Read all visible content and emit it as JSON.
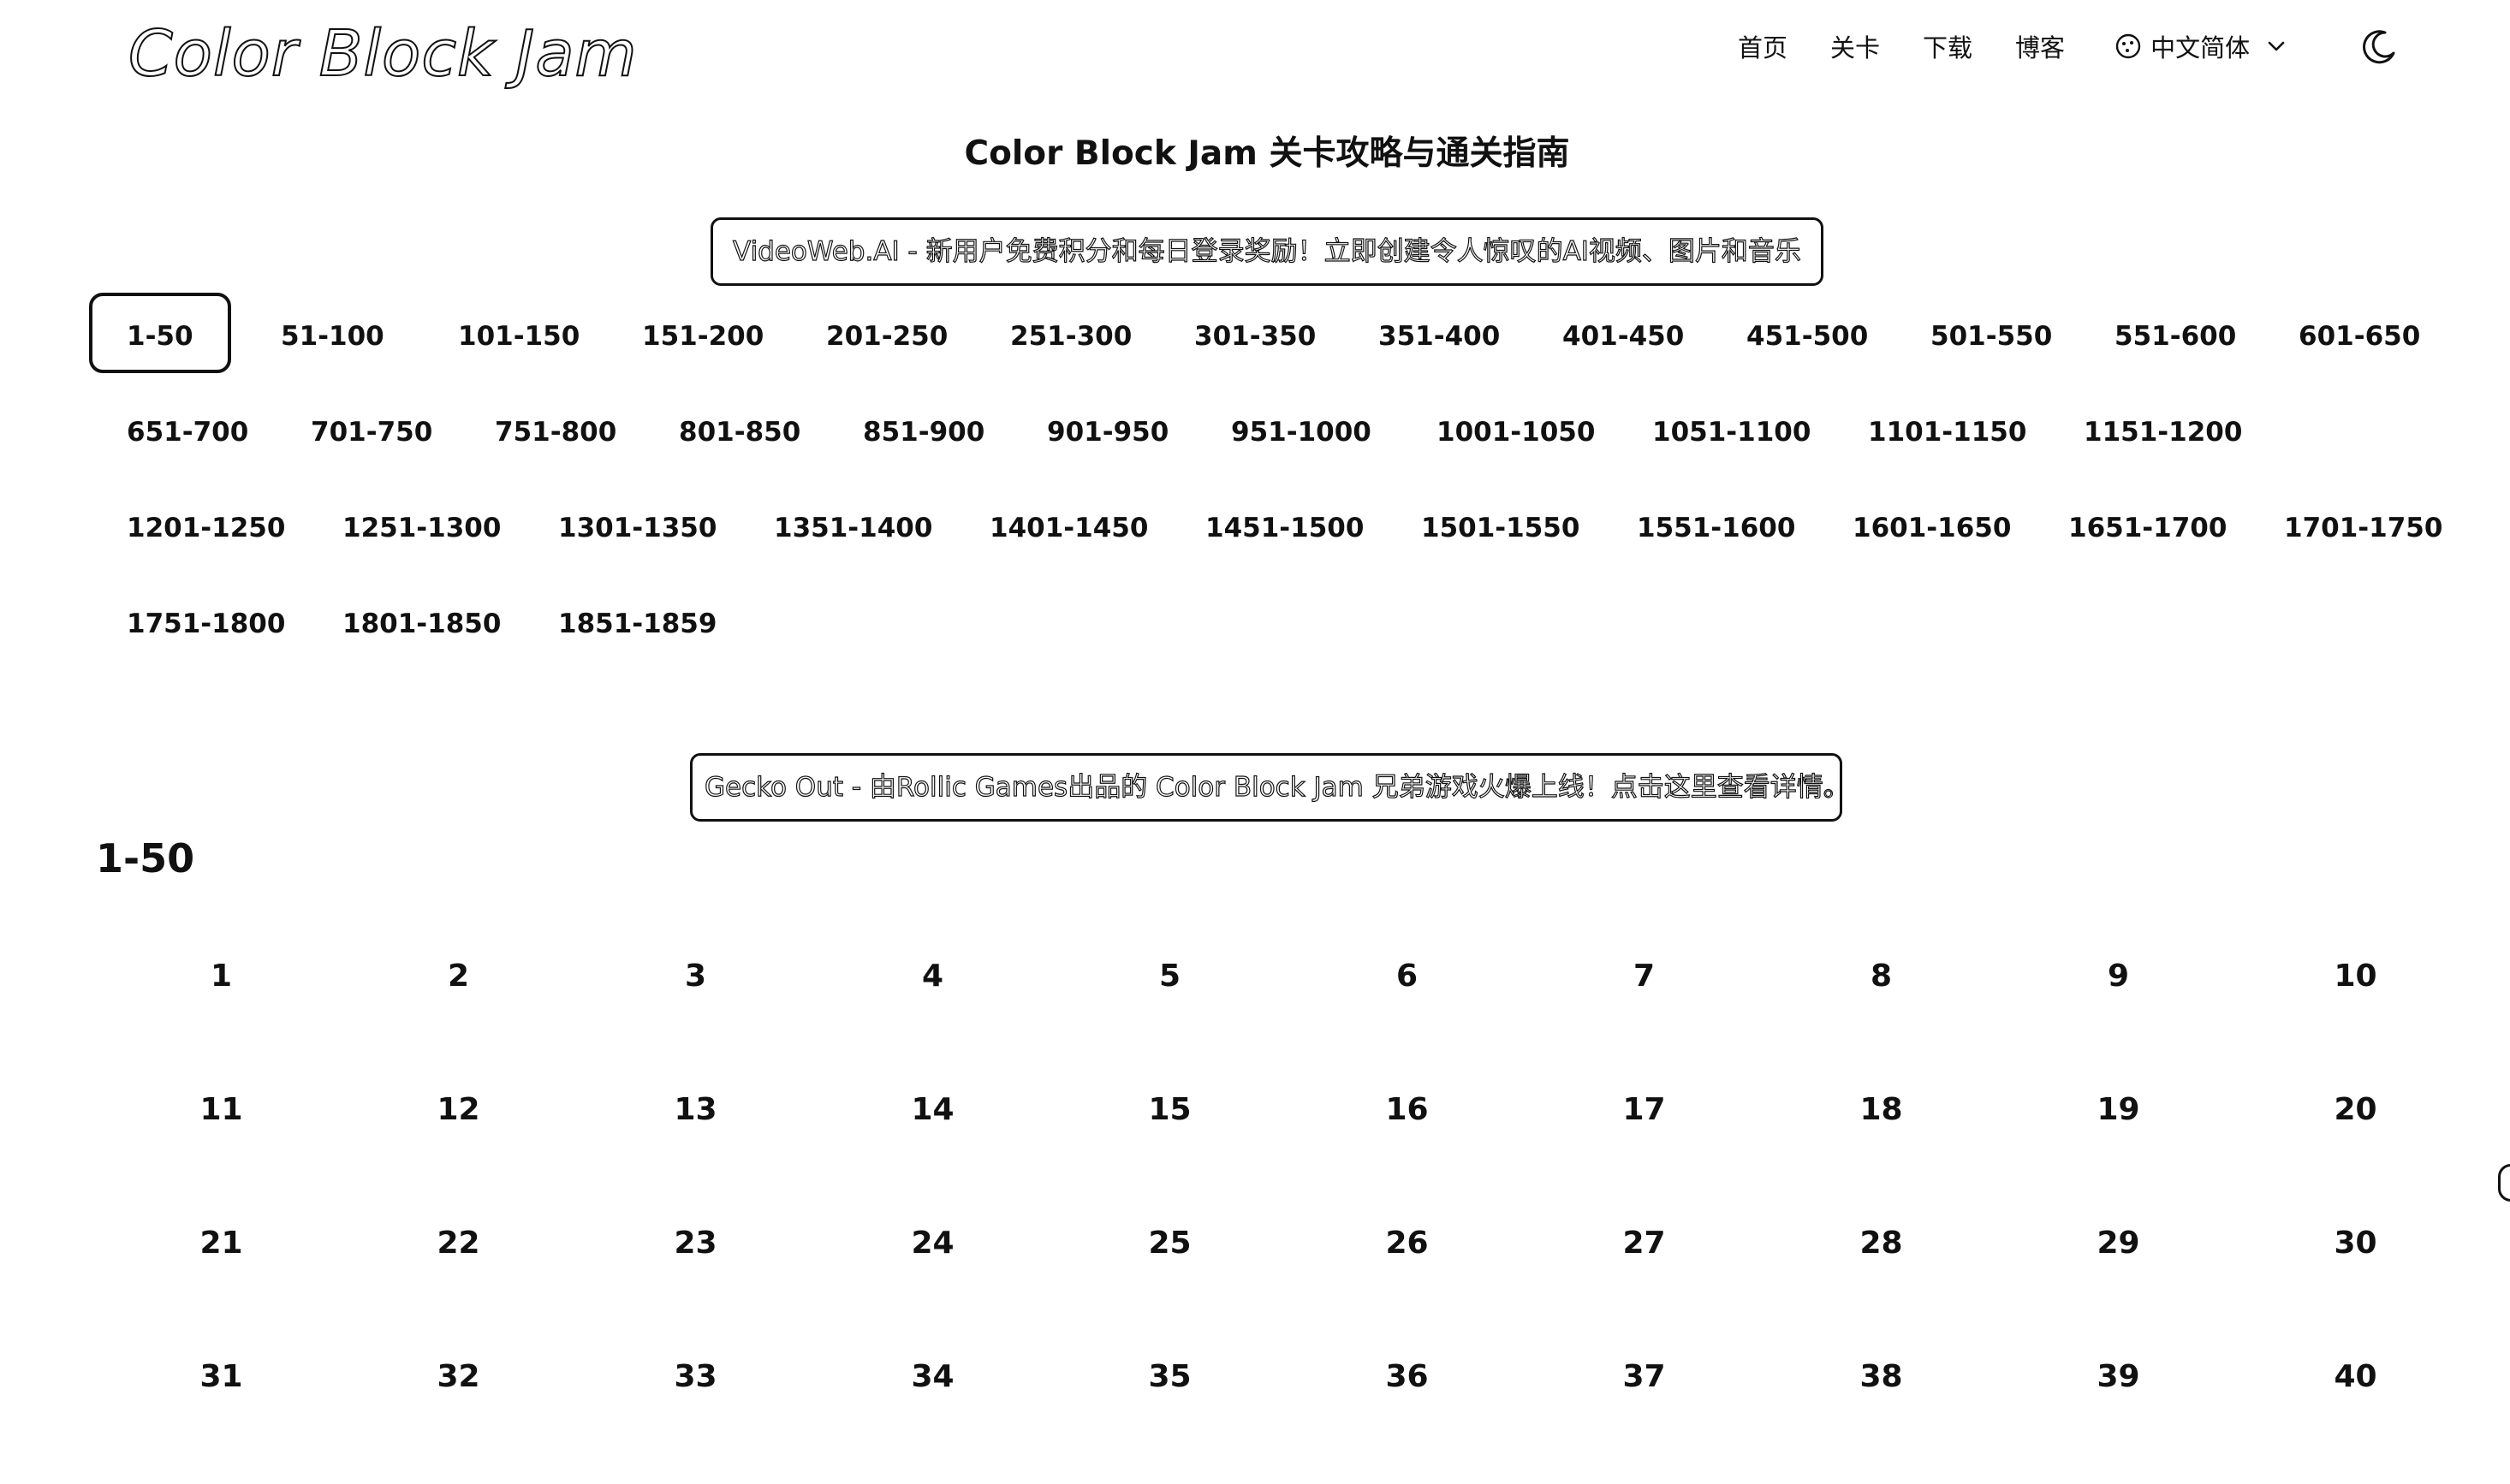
{
  "header": {
    "logo": "Color Block Jam",
    "nav": [
      {
        "label": "首页"
      },
      {
        "label": "关卡"
      },
      {
        "label": "下载"
      },
      {
        "label": "博客"
      }
    ],
    "language": "中文简体",
    "icons": {
      "language": "globe-icon",
      "dropdown": "chevron-down-icon",
      "theme": "moon-icon"
    }
  },
  "page_title": "Color Block Jam 关卡攻略与通关指南",
  "banners": {
    "top": "VideoWeb.AI - 新用户免费积分和每日登录奖励！立即创建令人惊叹的AI视频、图片和音乐",
    "bottom": "Gecko Out - 由Rollic Games出品的 Color Block Jam 兄弟游戏火爆上线！点击这里查看详情。"
  },
  "range_tabs": {
    "active": "1-50",
    "rows": [
      [
        "1-50",
        "51-100",
        "101-150",
        "151-200",
        "201-250",
        "251-300",
        "301-350",
        "351-400",
        "401-450",
        "451-500",
        "501-550",
        "551-600",
        "601-650"
      ],
      [
        "651-700",
        "701-750",
        "751-800",
        "801-850",
        "851-900",
        "901-950",
        "951-1000",
        "1001-1050",
        "1051-1100",
        "1101-1150",
        "1151-1200"
      ],
      [
        "1201-1250",
        "1251-1300",
        "1301-1350",
        "1351-1400",
        "1401-1450",
        "1451-1500",
        "1501-1550",
        "1551-1600",
        "1601-1650",
        "1651-1700",
        "1701-1750"
      ],
      [
        "1751-1800",
        "1801-1850",
        "1851-1859"
      ]
    ]
  },
  "section": {
    "heading": "1-50",
    "levels": [
      "1",
      "2",
      "3",
      "4",
      "5",
      "6",
      "7",
      "8",
      "9",
      "10",
      "11",
      "12",
      "13",
      "14",
      "15",
      "16",
      "17",
      "18",
      "19",
      "20",
      "21",
      "22",
      "23",
      "24",
      "25",
      "26",
      "27",
      "28",
      "29",
      "30",
      "31",
      "32",
      "33",
      "34",
      "35",
      "36",
      "37",
      "38",
      "39",
      "40"
    ]
  }
}
